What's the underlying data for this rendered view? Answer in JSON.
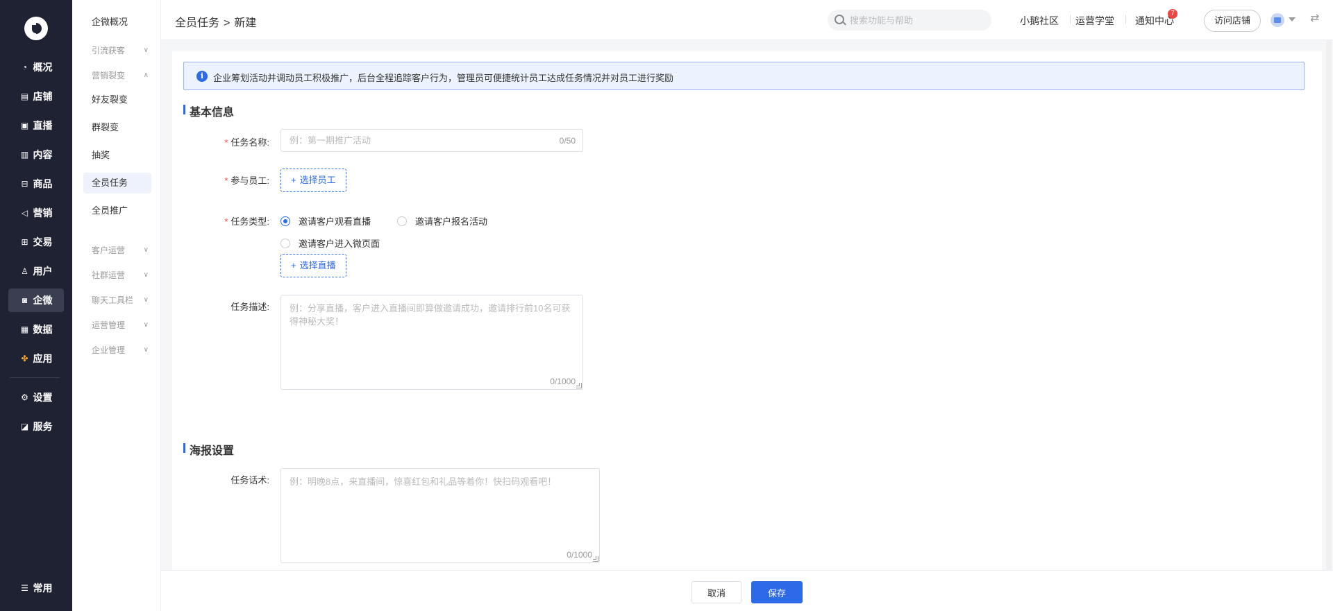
{
  "nav": {
    "items": [
      {
        "label": "概况",
        "icon": "dashboard-icon"
      },
      {
        "label": "店铺",
        "icon": "store-icon"
      },
      {
        "label": "直播",
        "icon": "live-icon"
      },
      {
        "label": "内容",
        "icon": "content-icon"
      },
      {
        "label": "商品",
        "icon": "goods-icon"
      },
      {
        "label": "营销",
        "icon": "marketing-icon"
      },
      {
        "label": "交易",
        "icon": "trade-icon"
      },
      {
        "label": "用户",
        "icon": "user-icon"
      },
      {
        "label": "企微",
        "icon": "wecom-icon"
      },
      {
        "label": "数据",
        "icon": "data-icon"
      },
      {
        "label": "应用",
        "icon": "apps-icon"
      }
    ],
    "bottom_items": [
      {
        "label": "设置",
        "icon": "settings-icon"
      },
      {
        "label": "服务",
        "icon": "service-icon"
      }
    ],
    "common_label": "常用",
    "active": "企微"
  },
  "subnav": {
    "overview": "企微概况",
    "group_traffic": "引流获客",
    "group_fission": "营销裂变",
    "fission_items": [
      "好友裂变",
      "群裂变",
      "抽奖",
      "全员任务",
      "全员推广"
    ],
    "active": "全员任务",
    "groups": [
      "客户运营",
      "社群运营",
      "聊天工具栏",
      "运营管理",
      "企业管理"
    ]
  },
  "header": {
    "breadcrumb_parent": "全员任务",
    "breadcrumb_sep": ">",
    "breadcrumb_current": "新建",
    "search_placeholder": "搜索功能与帮助",
    "links": [
      "小鹅社区",
      "运营学堂",
      "通知中心"
    ],
    "notice_count": "7",
    "visit_store": "访问店铺"
  },
  "notice": {
    "text": "企业筹划活动并调动员工积极推广，后台全程追踪客户行为，管理员可便捷统计员工达成任务情况并对员工进行奖励"
  },
  "basic": {
    "title": "基本信息",
    "task_name_label": "任务名称:",
    "task_name_placeholder": "例：第一期推广活动",
    "task_name_count": "0/50",
    "staff_label": "参与员工:",
    "staff_button": "选择员工",
    "type_label": "任务类型:",
    "type_options": [
      "邀请客户观看直播",
      "邀请客户报名活动",
      "邀请客户进入微页面"
    ],
    "type_selected": "邀请客户观看直播",
    "live_button": "选择直播",
    "desc_label": "任务描述:",
    "desc_placeholder": "例：分享直播，客户进入直播间即算做邀请成功，邀请排行前10名可获得神秘大奖！",
    "desc_count": "0/1000"
  },
  "poster": {
    "title": "海报设置",
    "script_label": "任务话术:",
    "script_placeholder": "例：明晚8点，来直播间，惊喜红包和礼品等着你！快扫码观看吧！",
    "script_count": "0/1000"
  },
  "footer": {
    "cancel": "取消",
    "save": "保存"
  },
  "colors": {
    "primary": "#2d6ae8",
    "sidebar": "#1f2233",
    "badge": "#f04545"
  }
}
